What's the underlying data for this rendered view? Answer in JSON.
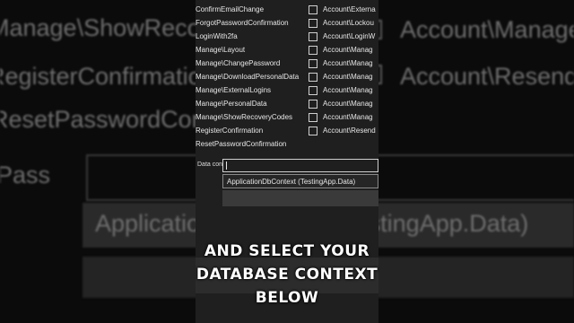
{
  "background": {
    "left_lines": [
      "Manage\\ShowReco",
      "RegisterConfirmation",
      "ResetPasswordConfi",
      "Pass"
    ],
    "right_lines": [
      "Account\\Manage",
      "Account\\Resend"
    ],
    "context_value": "ApplicationDbContext (TestingApp.Data)"
  },
  "pages": [
    {
      "name": "ConfirmEmailChange",
      "value": "Account\\Externa"
    },
    {
      "name": "ForgotPasswordConfirmation",
      "value": "Account\\Lockou"
    },
    {
      "name": "LoginWith2fa",
      "value": "Account\\LoginW"
    },
    {
      "name": "Manage\\Layout",
      "value": "Account\\Manag"
    },
    {
      "name": "Manage\\ChangePassword",
      "value": "Account\\Manag"
    },
    {
      "name": "Manage\\DownloadPersonalData",
      "value": "Account\\Manag"
    },
    {
      "name": "Manage\\ExternalLogins",
      "value": "Account\\Manag"
    },
    {
      "name": "Manage\\PersonalData",
      "value": "Account\\Manag"
    },
    {
      "name": "Manage\\ShowRecoveryCodes",
      "value": "Account\\Manag"
    },
    {
      "name": "RegisterConfirmation",
      "value": "Account\\Resend"
    },
    {
      "name": "ResetPasswordConfirmation",
      "value": ""
    }
  ],
  "data_context": {
    "label": "Data context class",
    "input_value": "",
    "option": "ApplicationDbContext (TestingApp.Data)"
  },
  "caption": "AND SELECT YOUR DATABASE CONTEXT BELOW"
}
